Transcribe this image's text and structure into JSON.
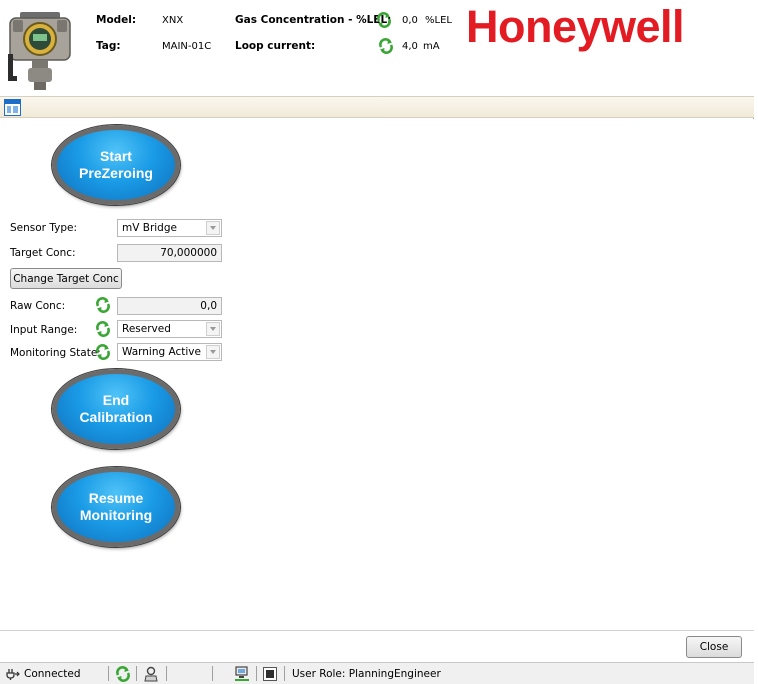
{
  "header": {
    "model_label": "Model:",
    "model_value": "XNX",
    "tag_label": "Tag:",
    "tag_value": "MAIN-01C",
    "gas_label": "Gas Concentration - %LEL:",
    "gas_value": "0,0",
    "gas_unit": "%LEL",
    "loop_label": "Loop current:",
    "loop_value": "4,0",
    "loop_unit": "mA",
    "logo": "Honeywell",
    "logo_color": "#e31b23"
  },
  "toolbar": {
    "icon": "window-layout-icon"
  },
  "buttons": {
    "start_prezeroing": "Start\nPreZeroing",
    "end_calibration": "End\nCalibration",
    "resume_monitoring": "Resume\nMonitoring",
    "change_target_conc": "Change Target Conc",
    "close": "Close"
  },
  "form": {
    "sensor_type_label": "Sensor Type:",
    "sensor_type_value": "mV Bridge",
    "target_conc_label": "Target Conc:",
    "target_conc_value": "70,000000",
    "raw_conc_label": "Raw Conc:",
    "raw_conc_value": "0,0",
    "input_range_label": "Input Range:",
    "input_range_value": "Reserved",
    "monitoring_state_label": "Monitoring State:",
    "monitoring_state_value": "Warning Active"
  },
  "statusbar": {
    "connection": "Connected",
    "user_role": "User Role: PlanningEngineer"
  },
  "colors": {
    "accent_button": "#1a9be6",
    "refresh_icon": "#3aa635"
  }
}
